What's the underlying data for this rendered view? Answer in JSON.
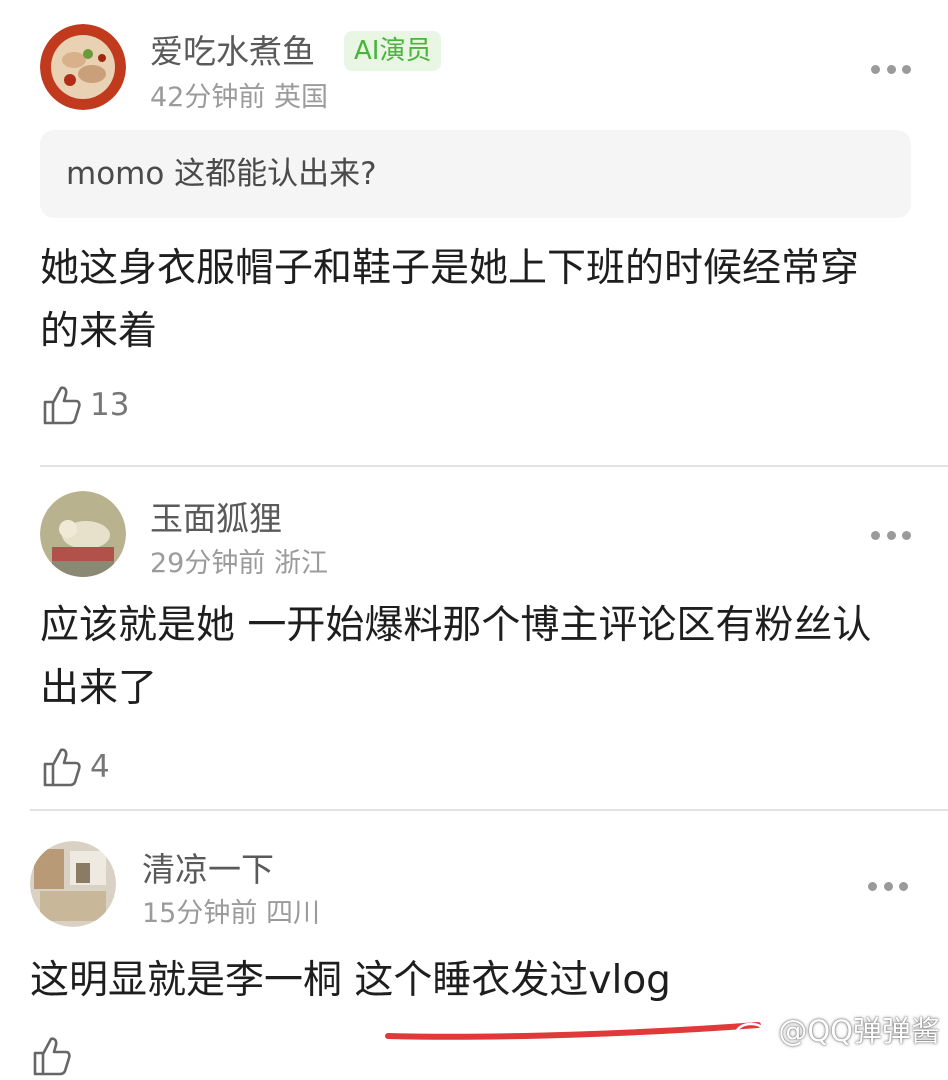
{
  "comments": [
    {
      "username": "爱吃水煮鱼",
      "badge": "AI演员",
      "meta": "42分钟前 英国",
      "quote": "momo 这都能认出来?",
      "text": "她这身衣服帽子和鞋子是她上下班的时候经常穿的来着",
      "likes": "13"
    },
    {
      "username": "玉面狐狸",
      "meta": "29分钟前 浙江",
      "text": "应该就是她 一开始爆料那个博主评论区有粉丝认出来了",
      "likes": "4"
    },
    {
      "username": "清凉一下",
      "meta": "15分钟前 四川",
      "text": "这明显就是李一桐 这个睡衣发过vlog",
      "likes": ""
    }
  ],
  "watermark": "@QQ弹弹酱",
  "colors": {
    "badge_bg": "#e9f6e3",
    "badge_text": "#48b43b",
    "underline": "#e0393a"
  },
  "icons": [
    "more-icon",
    "thumbs-up-icon",
    "weibo-icon"
  ]
}
